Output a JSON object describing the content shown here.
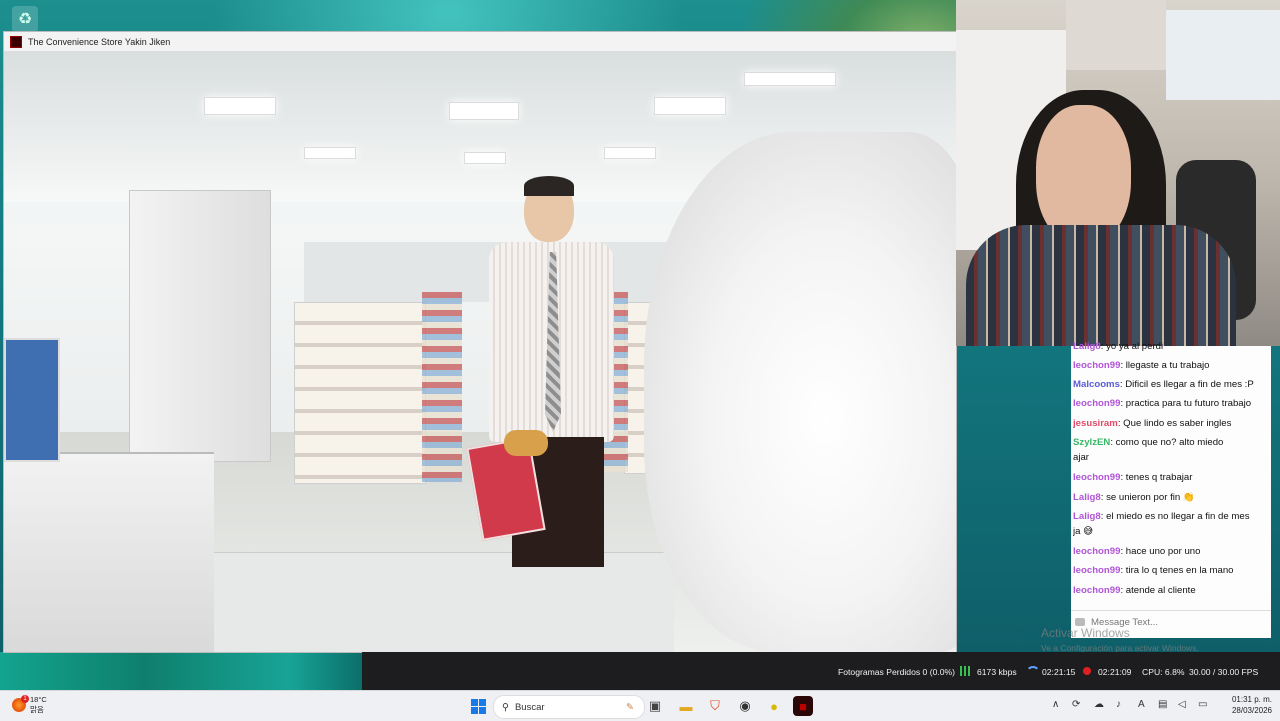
{
  "game_window": {
    "title": "The Convenience Store Yakin Jiken"
  },
  "chat": {
    "messages": [
      {
        "user": "Lalig8",
        "text": ": yo ya al perdi",
        "color": "#b155d6"
      },
      {
        "user": "leochon99",
        "text": ": llegaste a tu trabajo",
        "color": "#b155d6"
      },
      {
        "user": "Malcooms",
        "text": ": Dificil es llegar a fin de mes :P",
        "color": "#5b5bd6"
      },
      {
        "user": "leochon99",
        "text": ": practica para tu futuro trabajo",
        "color": "#b155d6"
      },
      {
        "user": "jesusiram",
        "text": ": Que lindo es saber ingles",
        "color": "#e04a6a"
      },
      {
        "user": "SzylzEN",
        "text": ": como que no? alto miedo",
        "continuation": "ajar",
        "color": "#37b866"
      },
      {
        "user": "leochon99",
        "text": ": tenes q trabajar",
        "color": "#b155d6"
      },
      {
        "user": "Lalig8",
        "text": ": se unieron por fin 👏",
        "color": "#b155d6"
      },
      {
        "user": "Lalig8",
        "text": ": el miedo es no llegar a fin de mes",
        "continuation": "ja 😅",
        "color": "#b155d6"
      },
      {
        "user": "leochon99",
        "text": ": hace uno por uno",
        "color": "#b155d6"
      },
      {
        "user": "leochon99",
        "text": ": tira lo q tenes en la mano",
        "color": "#b155d6"
      },
      {
        "user": "leochon99",
        "text": ": atende al cliente",
        "color": "#b155d6"
      }
    ],
    "input_placeholder": "Message Text..."
  },
  "activate_windows": {
    "title": "Activar Windows",
    "subtitle": "Ve a Configuración para activar Windows."
  },
  "stats": {
    "dropped_frames": "Fotogramas Perdidos 0 (0.0%)",
    "bitrate": "6173 kbps",
    "stream_time": "02:21:15",
    "rec_time": "02:21:09",
    "cpu": "CPU: 6.8%",
    "fps": "30.00 / 30.00 FPS"
  },
  "taskbar": {
    "weather_temp": "18°C",
    "weather_desc": "맑음",
    "weather_badge": "1",
    "search_placeholder": "Buscar",
    "time": "01:31 p. m.",
    "date": "28/03/2026"
  },
  "icons": {
    "recycle_bin": "recycle-icon",
    "start": "windows-start-icon",
    "search": "search-icon"
  }
}
